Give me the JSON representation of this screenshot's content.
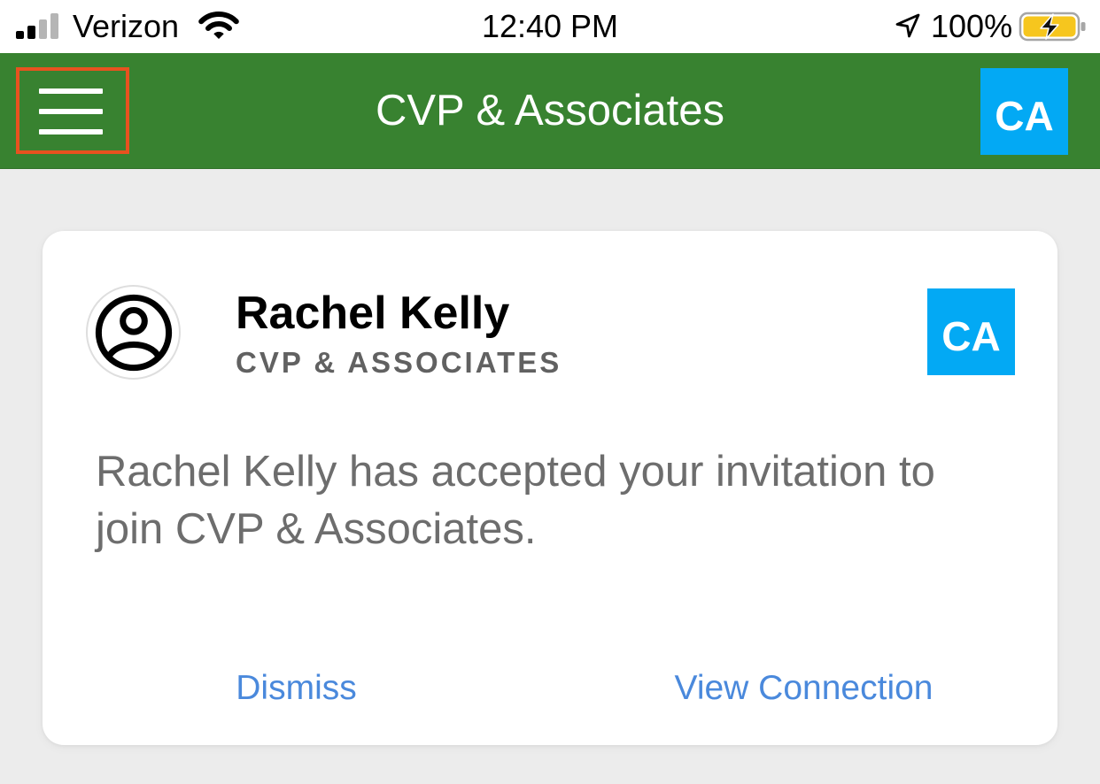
{
  "status_bar": {
    "carrier": "Verizon",
    "time": "12:40 PM",
    "battery_text": "100%",
    "signal_strength": 2,
    "signal_max": 4,
    "battery_level": 1.0,
    "charging": true,
    "icons": {
      "signal": "cellular-signal-icon",
      "wifi": "wifi-icon",
      "location": "location-arrow-icon",
      "battery": "battery-charging-icon"
    }
  },
  "header": {
    "title": "CVP & Associates",
    "menu_icon": "hamburger-menu-icon",
    "org_badge": "CA"
  },
  "notification": {
    "avatar_icon": "user-circle-icon",
    "name": "Rachel Kelly",
    "organization": "CVP & ASSOCIATES",
    "org_badge": "CA",
    "message": "Rachel Kelly has accepted your invitation to join CVP & Associates.",
    "actions": [
      {
        "label": "Dismiss"
      },
      {
        "label": "View Connection"
      }
    ]
  },
  "colors": {
    "header_background": "#388230",
    "org_badge": "#03a9f4",
    "action_text": "#4a89dc",
    "highlight_outline": "#e8521f",
    "battery_fill": "#f6c61e",
    "page_background": "#ececec"
  }
}
